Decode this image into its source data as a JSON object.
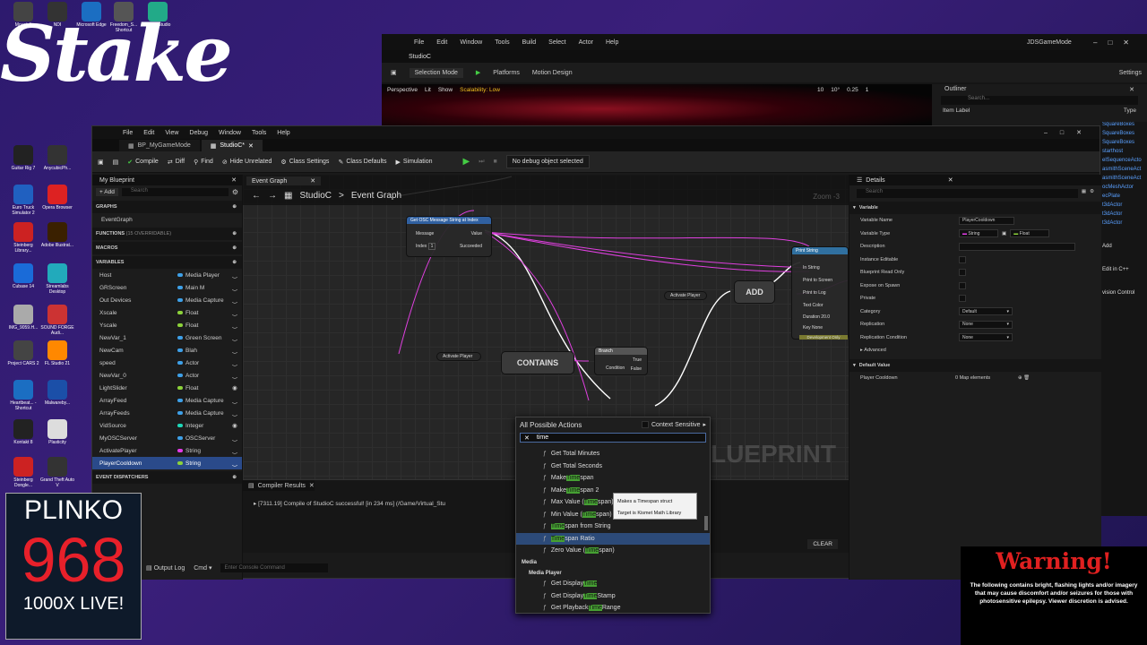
{
  "desktop": {
    "logo": "Stake",
    "icons": [
      {
        "label": "Mount &",
        "color": "#444"
      },
      {
        "label": "NDI",
        "color": "#333"
      },
      {
        "label": "Microsoft Edge",
        "color": "#1b6ec2"
      },
      {
        "label": "Freedom_S... Shortcut",
        "color": "#555"
      },
      {
        "label": "Camo Studio",
        "color": "#2a8"
      },
      {
        "label": "Guitar Rig 7",
        "color": "#222"
      },
      {
        "label": "AnycubicPh...",
        "color": "#333"
      },
      {
        "label": "Euro Truck Simulator 2",
        "color": "#2060c0"
      },
      {
        "label": "Opera Browser",
        "color": "#d22"
      },
      {
        "label": "Steinberg Library...",
        "color": "#c22"
      },
      {
        "label": "Adobe Illustrat...",
        "color": "#3a2000"
      },
      {
        "label": "Cubase 14",
        "color": "#1a6bd8"
      },
      {
        "label": "Streamlabs Desktop",
        "color": "#2ab"
      },
      {
        "label": "IMG_9059.H...",
        "color": "#aaa"
      },
      {
        "label": "SOUND FORGE Audi...",
        "color": "#c33"
      },
      {
        "label": "Project CARS 2",
        "color": "#444"
      },
      {
        "label": "FL Studio 21",
        "color": "#f80"
      },
      {
        "label": "Heartbeat... - Shortcut",
        "color": "#1b6ec2"
      },
      {
        "label": "Malwareby...",
        "color": "#1b4fa8"
      },
      {
        "label": "Kontakt 8",
        "color": "#222"
      },
      {
        "label": "Plasticity",
        "color": "#ddd"
      },
      {
        "label": "Steinberg Dongle...",
        "color": "#c22"
      },
      {
        "label": "Grand Theft Auto V",
        "color": "#333"
      }
    ]
  },
  "bg_editor": {
    "menu": [
      "File",
      "Edit",
      "Window",
      "Tools",
      "Build",
      "Select",
      "Actor",
      "Help"
    ],
    "tab": "StudioC",
    "window_title": "JDSGameMode",
    "toolbar": [
      "Selection Mode",
      "Platforms",
      "Motion Design",
      "Settings"
    ],
    "viewport": {
      "perspective": "Perspective",
      "lit": "Lit",
      "show": "Show",
      "scalability": "Scalability: Low",
      "grid": "10",
      "angle": "10°",
      "scale": "0.25",
      "cam": "1"
    },
    "outliner": {
      "title": "Outliner",
      "search": "Search...",
      "col_label": "Item Label",
      "col_type": "Type"
    }
  },
  "right_list": [
    "SquareBoxes",
    "SquareBoxes",
    "SquareBoxes",
    "starthost",
    "elSequenceActo",
    "asmithSceneAct",
    "asmithSceneAct",
    "ocMeshActor",
    "ecPlate",
    "t3dActor",
    "t3dActor",
    "t3dActor",
    "Add",
    "Edit in C++",
    "vision Control"
  ],
  "bp": {
    "menu": [
      "File",
      "Edit",
      "View",
      "Debug",
      "Window",
      "Tools",
      "Help"
    ],
    "tabs": [
      {
        "label": "BP_MyGameMode"
      },
      {
        "label": "StudioC*"
      }
    ],
    "toolbar": {
      "compile": "Compile",
      "diff": "Diff",
      "find": "Find",
      "hide_unrelated": "Hide Unrelated",
      "class_settings": "Class Settings",
      "class_defaults": "Class Defaults",
      "simulation": "Simulation",
      "debug_object": "No debug object selected"
    },
    "my_blueprint": {
      "title": "My Blueprint",
      "add": "Add",
      "search_placeholder": "Search",
      "graphs_label": "GRAPHS",
      "event_graph": "EventGraph",
      "functions_label": "FUNCTIONS",
      "functions_note": "(15 OVERRIDABLE)",
      "macros_label": "MACROS",
      "variables_label": "VARIABLES",
      "event_dispatchers_label": "EVENT DISPATCHERS",
      "variables": [
        {
          "name": "Host",
          "type": "Media Player",
          "color": "#3ea0e8",
          "eye": false
        },
        {
          "name": "GRScreen",
          "type": "Main M",
          "color": "#3ea0e8",
          "eye": false
        },
        {
          "name": "Out Devices",
          "type": "Media Capture",
          "color": "#3ea0e8",
          "eye": false
        },
        {
          "name": "Xscale",
          "type": "Float",
          "color": "#8cd23a",
          "eye": false
        },
        {
          "name": "Yscale",
          "type": "Float",
          "color": "#8cd23a",
          "eye": false
        },
        {
          "name": "NewVar_1",
          "type": "Green Screen",
          "color": "#3ea0e8",
          "eye": false
        },
        {
          "name": "NewCam",
          "type": "Blah",
          "color": "#3ea0e8",
          "eye": false
        },
        {
          "name": "speed",
          "type": "Actor",
          "color": "#3ea0e8",
          "eye": false
        },
        {
          "name": "NewVar_0",
          "type": "Actor",
          "color": "#3ea0e8",
          "eye": false
        },
        {
          "name": "LightSlider",
          "type": "Float",
          "color": "#8cd23a",
          "eye": true
        },
        {
          "name": "ArrayFeed",
          "type": "Media Capture",
          "color": "#3ea0e8",
          "eye": false
        },
        {
          "name": "ArrayFeeds",
          "type": "Media Capture",
          "color": "#3ea0e8",
          "eye": false
        },
        {
          "name": "VidSource",
          "type": "Integer",
          "color": "#1ed7b8",
          "eye": true
        },
        {
          "name": "MyOSCServer",
          "type": "OSCServer",
          "color": "#3ea0e8",
          "eye": false
        },
        {
          "name": "ActivatePlayer",
          "type": "String",
          "color": "#e43ce8",
          "eye": false
        },
        {
          "name": "PlayerCooldown",
          "type": "String",
          "color": "#8cd23a",
          "eye": false,
          "selected": true
        }
      ]
    },
    "graph": {
      "tab": "Event Graph",
      "breadcrumb_root": "StudioC",
      "breadcrumb_sep": ">",
      "breadcrumb_leaf": "Event Graph",
      "zoom": "Zoom -3",
      "watermark": "BLUEPRINT",
      "nodes": {
        "osc": {
          "title": "Get OSC Message String at Index",
          "pins": [
            "Message",
            "Value",
            "Index",
            "Succeeded"
          ],
          "index_val": "1"
        },
        "activate1": "Activate Player",
        "activate2": "Activate Player",
        "contains": "CONTAINS",
        "add": "ADD",
        "branch": {
          "title": "Branch",
          "pins": [
            "Condition",
            "True",
            "False"
          ]
        },
        "print": {
          "title": "Print String",
          "pins": [
            "In String",
            "Print to Screen",
            "Print to Log",
            "Text Color",
            "Duration",
            "Key"
          ],
          "duration": "20.0",
          "key": "None",
          "dev": "Development Only"
        }
      }
    },
    "compiler": {
      "title": "Compiler Results",
      "message": "[7311.19] Compile of StudioC successful! [in 234 ms] (/Game/Virtual_Stu",
      "clear": "CLEAR"
    },
    "status": {
      "output_log": "Output Log",
      "cmd": "Cmd",
      "console_placeholder": "Enter Console Command"
    },
    "details": {
      "title": "Details",
      "search_placeholder": "Search",
      "section_variable": "Variable",
      "rows": [
        {
          "label": "Variable Name",
          "value": "PlayerCooldown",
          "kind": "field"
        },
        {
          "label": "Variable Type",
          "value": "String",
          "value2": "Float",
          "kind": "type"
        },
        {
          "label": "Description",
          "value": "",
          "kind": "wide"
        },
        {
          "label": "Instance Editable",
          "kind": "check"
        },
        {
          "label": "Blueprint Read Only",
          "kind": "check"
        },
        {
          "label": "Expose on Spawn",
          "kind": "check"
        },
        {
          "label": "Private",
          "kind": "check"
        },
        {
          "label": "Category",
          "value": "Default",
          "kind": "select"
        },
        {
          "label": "Replication",
          "value": "None",
          "kind": "select"
        },
        {
          "label": "Replication Condition",
          "value": "None",
          "kind": "select"
        }
      ],
      "advanced": "Advanced",
      "section_default": "Default Value",
      "default_row": {
        "label": "Player Cooldown",
        "value": "0 Map elements"
      }
    }
  },
  "context_menu": {
    "title": "All Possible Actions",
    "context_sensitive": "Context Sensitive",
    "search_value": "time",
    "items": [
      {
        "pre": "Get Total Minutes",
        "hl": "",
        "post": ""
      },
      {
        "pre": "Get Total Seconds",
        "hl": "",
        "post": ""
      },
      {
        "pre": "Make ",
        "hl": "Time",
        "post": "span"
      },
      {
        "pre": "Make ",
        "hl": "Time",
        "post": "span 2"
      },
      {
        "pre": "Max Value (",
        "hl": "Time",
        "post": "span)"
      },
      {
        "pre": "Min Value (",
        "hl": "Time",
        "post": "span)"
      },
      {
        "pre": "",
        "hl": "Time",
        "post": "span from String"
      },
      {
        "pre": "",
        "hl": "Time",
        "post": "span Ratio",
        "selected": true
      },
      {
        "pre": "Zero Value (",
        "hl": "Time",
        "post": "span)"
      }
    ],
    "category_media": "Media",
    "category_media_player": "Media Player",
    "media_items": [
      {
        "pre": "Get Display ",
        "hl": "Time",
        "post": ""
      },
      {
        "pre": "Get Display ",
        "hl": "Time",
        "post": " Stamp"
      },
      {
        "pre": "Get Playback ",
        "hl": "Time",
        "post": " Range"
      }
    ],
    "tooltip_line1": "Makes a Timespan struct",
    "tooltip_line2": "Target is Kismet Math Library"
  },
  "overlays": {
    "plinko_title": "PLINKO",
    "plinko_number": "968",
    "plinko_live": "1000X LIVE!",
    "warning_title": "Warning!",
    "warning_text": "The following contains bright, flashing lights and/or imagery that may cause discomfort and/or seizures for those with photosensitive epilepsy. Viewer discretion is advised."
  }
}
